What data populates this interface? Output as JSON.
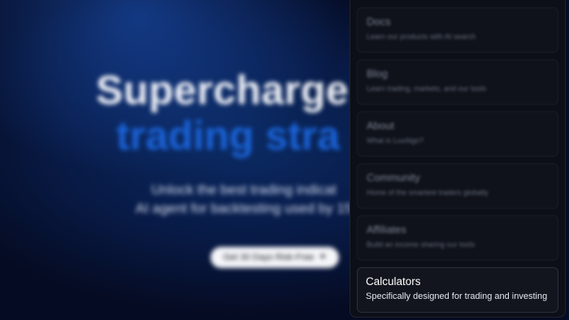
{
  "hero": {
    "title_line1": "Supercharge",
    "title_line2": "trading stra",
    "subtitle_line1": "Unlock the best trading indicat",
    "subtitle_line2": "AI agent for backtesting used by 15",
    "cta_label": "Get 30 Days Risk-Free",
    "cta_icon": "arrow-right-icon"
  },
  "menu": {
    "items": [
      {
        "title": "Docs",
        "description": "Learn our products with AI search"
      },
      {
        "title": "Blog",
        "description": "Learn trading, markets, and our tools"
      },
      {
        "title": "About",
        "description": "What is LuxAlgo?"
      },
      {
        "title": "Community",
        "description": "Home of the smartest traders globally"
      },
      {
        "title": "Affiliates",
        "description": "Build an income sharing our tools"
      },
      {
        "title": "Calculators",
        "description": "Specifically designed for trading and investing"
      }
    ]
  },
  "colors": {
    "accent": "#1a63d8",
    "panel_bg": "#0c0f17",
    "hero_bg": "#081a45"
  }
}
